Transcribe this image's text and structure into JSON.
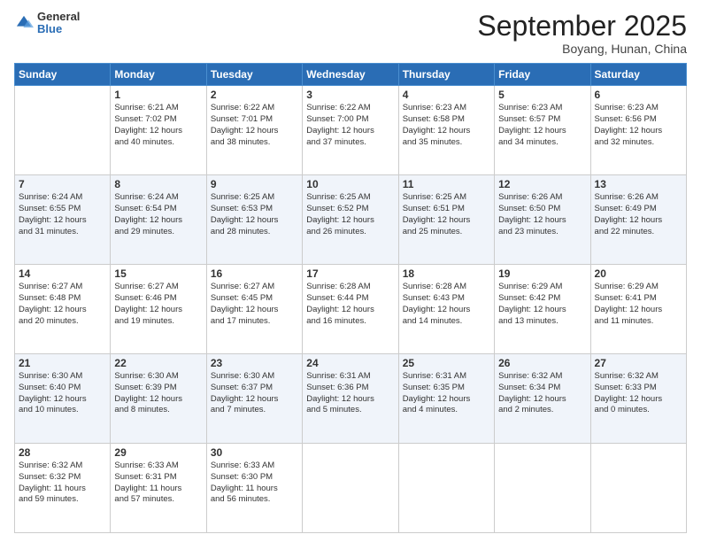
{
  "header": {
    "logo": {
      "general": "General",
      "blue": "Blue"
    },
    "title": "September 2025",
    "location": "Boyang, Hunan, China"
  },
  "weekdays": [
    "Sunday",
    "Monday",
    "Tuesday",
    "Wednesday",
    "Thursday",
    "Friday",
    "Saturday"
  ],
  "weeks": [
    [
      {
        "day": "",
        "detail": ""
      },
      {
        "day": "1",
        "detail": "Sunrise: 6:21 AM\nSunset: 7:02 PM\nDaylight: 12 hours\nand 40 minutes."
      },
      {
        "day": "2",
        "detail": "Sunrise: 6:22 AM\nSunset: 7:01 PM\nDaylight: 12 hours\nand 38 minutes."
      },
      {
        "day": "3",
        "detail": "Sunrise: 6:22 AM\nSunset: 7:00 PM\nDaylight: 12 hours\nand 37 minutes."
      },
      {
        "day": "4",
        "detail": "Sunrise: 6:23 AM\nSunset: 6:58 PM\nDaylight: 12 hours\nand 35 minutes."
      },
      {
        "day": "5",
        "detail": "Sunrise: 6:23 AM\nSunset: 6:57 PM\nDaylight: 12 hours\nand 34 minutes."
      },
      {
        "day": "6",
        "detail": "Sunrise: 6:23 AM\nSunset: 6:56 PM\nDaylight: 12 hours\nand 32 minutes."
      }
    ],
    [
      {
        "day": "7",
        "detail": "Sunrise: 6:24 AM\nSunset: 6:55 PM\nDaylight: 12 hours\nand 31 minutes."
      },
      {
        "day": "8",
        "detail": "Sunrise: 6:24 AM\nSunset: 6:54 PM\nDaylight: 12 hours\nand 29 minutes."
      },
      {
        "day": "9",
        "detail": "Sunrise: 6:25 AM\nSunset: 6:53 PM\nDaylight: 12 hours\nand 28 minutes."
      },
      {
        "day": "10",
        "detail": "Sunrise: 6:25 AM\nSunset: 6:52 PM\nDaylight: 12 hours\nand 26 minutes."
      },
      {
        "day": "11",
        "detail": "Sunrise: 6:25 AM\nSunset: 6:51 PM\nDaylight: 12 hours\nand 25 minutes."
      },
      {
        "day": "12",
        "detail": "Sunrise: 6:26 AM\nSunset: 6:50 PM\nDaylight: 12 hours\nand 23 minutes."
      },
      {
        "day": "13",
        "detail": "Sunrise: 6:26 AM\nSunset: 6:49 PM\nDaylight: 12 hours\nand 22 minutes."
      }
    ],
    [
      {
        "day": "14",
        "detail": "Sunrise: 6:27 AM\nSunset: 6:48 PM\nDaylight: 12 hours\nand 20 minutes."
      },
      {
        "day": "15",
        "detail": "Sunrise: 6:27 AM\nSunset: 6:46 PM\nDaylight: 12 hours\nand 19 minutes."
      },
      {
        "day": "16",
        "detail": "Sunrise: 6:27 AM\nSunset: 6:45 PM\nDaylight: 12 hours\nand 17 minutes."
      },
      {
        "day": "17",
        "detail": "Sunrise: 6:28 AM\nSunset: 6:44 PM\nDaylight: 12 hours\nand 16 minutes."
      },
      {
        "day": "18",
        "detail": "Sunrise: 6:28 AM\nSunset: 6:43 PM\nDaylight: 12 hours\nand 14 minutes."
      },
      {
        "day": "19",
        "detail": "Sunrise: 6:29 AM\nSunset: 6:42 PM\nDaylight: 12 hours\nand 13 minutes."
      },
      {
        "day": "20",
        "detail": "Sunrise: 6:29 AM\nSunset: 6:41 PM\nDaylight: 12 hours\nand 11 minutes."
      }
    ],
    [
      {
        "day": "21",
        "detail": "Sunrise: 6:30 AM\nSunset: 6:40 PM\nDaylight: 12 hours\nand 10 minutes."
      },
      {
        "day": "22",
        "detail": "Sunrise: 6:30 AM\nSunset: 6:39 PM\nDaylight: 12 hours\nand 8 minutes."
      },
      {
        "day": "23",
        "detail": "Sunrise: 6:30 AM\nSunset: 6:37 PM\nDaylight: 12 hours\nand 7 minutes."
      },
      {
        "day": "24",
        "detail": "Sunrise: 6:31 AM\nSunset: 6:36 PM\nDaylight: 12 hours\nand 5 minutes."
      },
      {
        "day": "25",
        "detail": "Sunrise: 6:31 AM\nSunset: 6:35 PM\nDaylight: 12 hours\nand 4 minutes."
      },
      {
        "day": "26",
        "detail": "Sunrise: 6:32 AM\nSunset: 6:34 PM\nDaylight: 12 hours\nand 2 minutes."
      },
      {
        "day": "27",
        "detail": "Sunrise: 6:32 AM\nSunset: 6:33 PM\nDaylight: 12 hours\nand 0 minutes."
      }
    ],
    [
      {
        "day": "28",
        "detail": "Sunrise: 6:32 AM\nSunset: 6:32 PM\nDaylight: 11 hours\nand 59 minutes."
      },
      {
        "day": "29",
        "detail": "Sunrise: 6:33 AM\nSunset: 6:31 PM\nDaylight: 11 hours\nand 57 minutes."
      },
      {
        "day": "30",
        "detail": "Sunrise: 6:33 AM\nSunset: 6:30 PM\nDaylight: 11 hours\nand 56 minutes."
      },
      {
        "day": "",
        "detail": ""
      },
      {
        "day": "",
        "detail": ""
      },
      {
        "day": "",
        "detail": ""
      },
      {
        "day": "",
        "detail": ""
      }
    ]
  ]
}
